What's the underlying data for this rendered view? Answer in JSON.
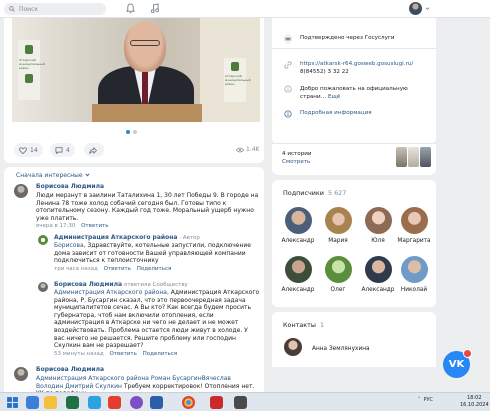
{
  "topbar": {
    "search_placeholder": "Поиск"
  },
  "post": {
    "banner_text": "Аткарский муниципальный район",
    "likes": "14",
    "comments": "4",
    "views": "1.4K",
    "slides": 2,
    "active_slide": 1
  },
  "comments": {
    "sort_label": "Сначала интересные",
    "items": [
      {
        "author": "Борисова Людмила",
        "text": "Люди мерзнут в заилини Таталихина 1, 30 лет Победы 9. В городе на Ленина 78 тоже холод собачий сегодня был. Готовы типо к отопительному сезону. Каждый год тоже. Моральный ущерб нужно уже платить.",
        "time": "вчера в 17:30",
        "reply": "Ответить"
      },
      {
        "author": "Администрация Аткарского района",
        "author_tag": "· Автор",
        "addressee": "Борисова,",
        "text": " Здравствуйте, котельные запустили, подключение дома зависит от готовности Вашей управляющей компании подключиться к теплоисточнику",
        "time": "три часа назад",
        "reply": "Ответить",
        "share": "Поделиться"
      },
      {
        "author": "Борисова Людмила",
        "author_tag": "ответила Сообществу",
        "addressee": "Администрация Аткарского района,",
        "text": " Администрация Аткарского района, Р. Бусаргин сказал, что это первоочередная задача муниципалитетов сечас. А Вы кто? Как всегда будем просить губернатора, чтоб нам включили отопления, если администрация в Аткарске ни чего не делает и не может воздействовать. Проблема остается люди живут в холоде. У вас ничего не решается. Решите проблему или господин Скулкин вам не разрешает?",
        "time": "53 минуты назад",
        "reply": "Ответить",
        "share": "Поделиться"
      },
      {
        "author": "Борисова Людмила",
        "text_link": "Администрация Аткарского района Роман БусаргинВячеслав Володин Дмитрий Скулкин",
        "text": " Требуем корректировок! Отопления нет. УК по телефону"
      }
    ]
  },
  "info": {
    "verified": "Подтверждено через Госуслуги",
    "site": "https://atkarsk-r64.gosweb.gosuslugi.ru/",
    "phone": "8(84552) 3 32 22",
    "welcome": "Добро пожаловать на официальную страни…",
    "more": "Ещё",
    "details": "Подробная информация"
  },
  "stories": {
    "count": "4 истории",
    "watch": "Смотреть"
  },
  "subscribers": {
    "title": "Подписчики",
    "count": "5 627",
    "people": [
      "Александр",
      "Мария",
      "Юля",
      "Маргарита",
      "Александр",
      "Олег",
      "Александр",
      "Николай"
    ]
  },
  "contacts": {
    "title": "Контакты",
    "count": "1",
    "person": "Анна Землянухина"
  },
  "taskbar": {
    "time": "18:02",
    "date": "16.10.2024",
    "lang": "РУС"
  },
  "colors": {
    "accent": "#2787f5",
    "link": "#2a5885"
  }
}
